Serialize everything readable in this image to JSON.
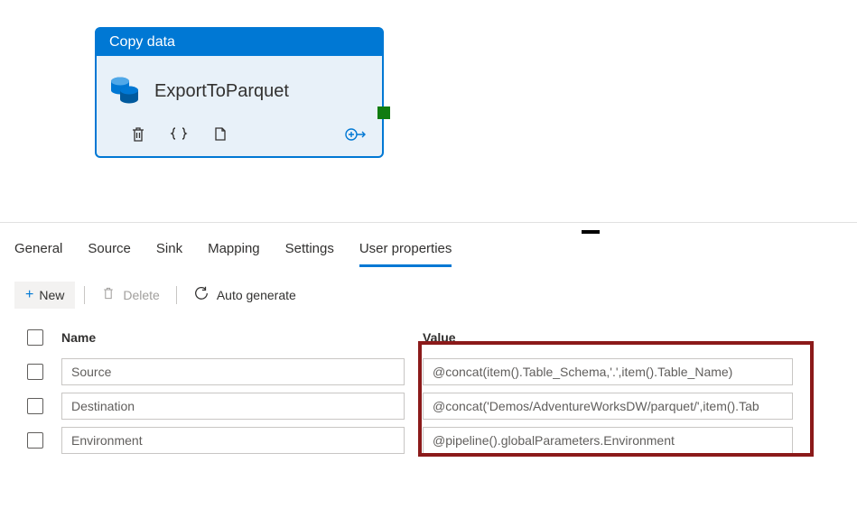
{
  "activity": {
    "header": "Copy data",
    "name": "ExportToParquet"
  },
  "tabs": [
    {
      "label": "General"
    },
    {
      "label": "Source"
    },
    {
      "label": "Sink"
    },
    {
      "label": "Mapping"
    },
    {
      "label": "Settings"
    },
    {
      "label": "User properties",
      "active": true
    }
  ],
  "toolbar": {
    "new_label": "New",
    "delete_label": "Delete",
    "auto_generate_label": "Auto generate"
  },
  "columns": {
    "name": "Name",
    "value": "Value"
  },
  "rows": [
    {
      "name": "Source",
      "value": "@concat(item().Table_Schema,'.',item().Table_Name)"
    },
    {
      "name": "Destination",
      "value": "@concat('Demos/AdventureWorksDW/parquet/',item().Tab"
    },
    {
      "name": "Environment",
      "value": "@pipeline().globalParameters.Environment"
    }
  ]
}
